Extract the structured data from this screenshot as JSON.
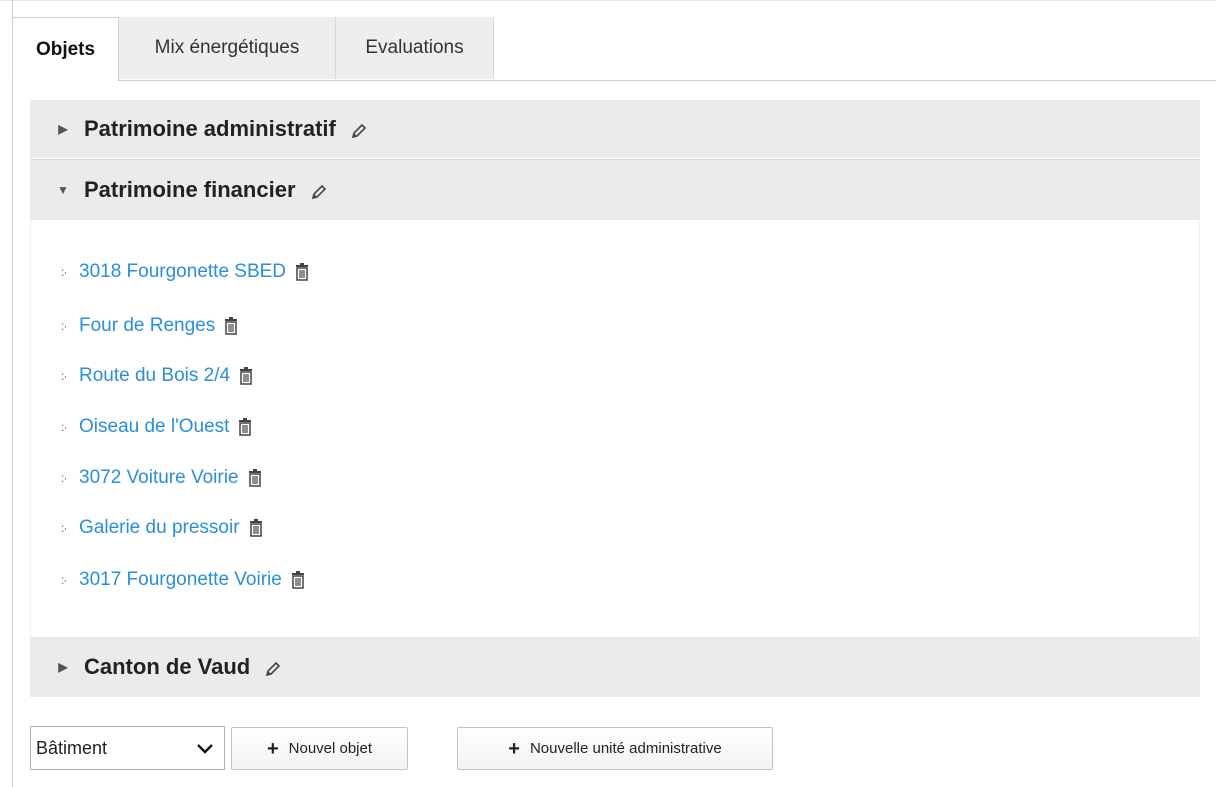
{
  "tabs": [
    {
      "label": "Objets",
      "active": true
    },
    {
      "label": "Mix énergétiques",
      "active": false
    },
    {
      "label": "Evaluations",
      "active": false
    }
  ],
  "groups": [
    {
      "title": "Patrimoine administratif",
      "expanded": false
    },
    {
      "title": "Patrimoine financier",
      "expanded": true,
      "items": [
        "3018 Fourgonette SBED",
        "Four de Renges",
        "Route du Bois 2/4",
        "Oiseau de l'Ouest",
        "3072 Voiture Voirie",
        "Galerie du pressoir",
        "3017 Fourgonette Voirie"
      ]
    },
    {
      "title": "Canton de Vaud",
      "expanded": false
    }
  ],
  "controls": {
    "type_select_value": "Bâtiment",
    "new_object_label": "Nouvel objet",
    "new_admin_unit_label": "Nouvelle unité administrative",
    "plus_symbol": "+"
  },
  "colors": {
    "link": "#2b8fd6",
    "header_bg": "#ebebeb",
    "tab_inactive_bg": "#eeeeee"
  },
  "icons": {
    "collapsed": "triangle-right-icon",
    "expanded": "triangle-down-icon",
    "edit": "pencil-icon",
    "delete": "trash-icon",
    "drag": "drag-handle-icon",
    "dropdown": "chevron-down-icon"
  }
}
